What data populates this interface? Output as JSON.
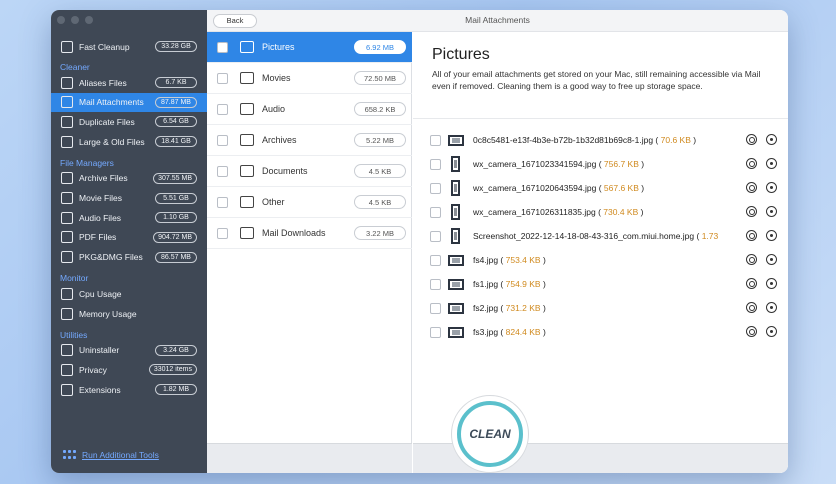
{
  "window": {
    "title": "Mail Attachments",
    "back_label": "Back"
  },
  "sidebar": {
    "top_item": {
      "label": "Fast Cleanup",
      "badge": "33.28 GB",
      "icon": "monitor-icon"
    },
    "sections": [
      {
        "title": "Cleaner",
        "items": [
          {
            "label": "Aliases Files",
            "badge": "6.7 KB",
            "icon": "alias-icon"
          },
          {
            "label": "Mail Attachments",
            "badge": "87.87 MB",
            "icon": "mail-icon",
            "active": true
          },
          {
            "label": "Duplicate Files",
            "badge": "6.54 GB",
            "icon": "duplicate-icon"
          },
          {
            "label": "Large & Old Files",
            "badge": "18.41 GB",
            "icon": "large-files-icon"
          }
        ]
      },
      {
        "title": "File Managers",
        "items": [
          {
            "label": "Archive Files",
            "badge": "307.55 MB",
            "icon": "archive-icon"
          },
          {
            "label": "Movie Files",
            "badge": "5.51 GB",
            "icon": "movie-icon"
          },
          {
            "label": "Audio Files",
            "badge": "1.10 GB",
            "icon": "audio-icon"
          },
          {
            "label": "PDF Files",
            "badge": "904.72 MB",
            "icon": "pdf-icon"
          },
          {
            "label": "PKG&DMG Files",
            "badge": "86.57 MB",
            "icon": "package-icon"
          }
        ]
      },
      {
        "title": "Monitor",
        "items": [
          {
            "label": "Cpu Usage",
            "badge": "",
            "icon": "cpu-icon"
          },
          {
            "label": "Memory Usage",
            "badge": "",
            "icon": "memory-icon"
          }
        ]
      },
      {
        "title": "Utilities",
        "items": [
          {
            "label": "Uninstaller",
            "badge": "3.24 GB",
            "icon": "trash-icon"
          },
          {
            "label": "Privacy",
            "badge": "33012 items",
            "icon": "shield-icon"
          },
          {
            "label": "Extensions",
            "badge": "1.82 MB",
            "icon": "extension-icon"
          }
        ]
      }
    ],
    "run_tools": "Run Additional Tools"
  },
  "categories": [
    {
      "label": "Pictures",
      "size": "6.92 MB",
      "icon": "pictures-icon",
      "active": true
    },
    {
      "label": "Movies",
      "size": "72.50 MB",
      "icon": "movie-camera-icon"
    },
    {
      "label": "Audio",
      "size": "658.2 KB",
      "icon": "music-note-icon"
    },
    {
      "label": "Archives",
      "size": "5.22 MB",
      "icon": "zip-icon"
    },
    {
      "label": "Documents",
      "size": "4.5 KB",
      "icon": "document-icon"
    },
    {
      "label": "Other",
      "size": "4.5 KB",
      "icon": "folder-icon"
    },
    {
      "label": "Mail Downloads",
      "size": "3.22 MB",
      "icon": "download-icon"
    }
  ],
  "detail": {
    "title": "Pictures",
    "description": "All of your email attachments get stored on your Mac, still remaining accessible via Mail even if removed. Cleaning them is a good way to free up storage space.",
    "files": [
      {
        "name": "0c8c5481-e13f-4b3e-b72b-1b32d81b69c8-1.jpg",
        "size": "70.6 KB",
        "thumb": "film"
      },
      {
        "name": "wx_camera_1671023341594.jpg",
        "size": "756.7 KB",
        "thumb": "tall"
      },
      {
        "name": "wx_camera_1671020643594.jpg",
        "size": "567.6 KB",
        "thumb": "tall"
      },
      {
        "name": "wx_camera_1671026311835.jpg",
        "size": "730.4 KB",
        "thumb": "tall"
      },
      {
        "name": "Screenshot_2022-12-14-18-08-43-316_com.miui.home.jpg",
        "size": "1.73",
        "thumb": "tall",
        "truncated": true
      },
      {
        "name": "fs4.jpg",
        "size": "753.4 KB",
        "thumb": "film"
      },
      {
        "name": "fs1.jpg",
        "size": "754.9 KB",
        "thumb": "film"
      },
      {
        "name": "fs2.jpg",
        "size": "731.2 KB",
        "thumb": "film"
      },
      {
        "name": "fs3.jpg",
        "size": "824.4 KB",
        "thumb": "film"
      }
    ]
  },
  "clean_label": "CLEAN",
  "colors": {
    "accent": "#2f86e6",
    "sidebar": "#3f4855",
    "size_text": "#d08a1f",
    "clean_ring": "#5bc0cc"
  }
}
